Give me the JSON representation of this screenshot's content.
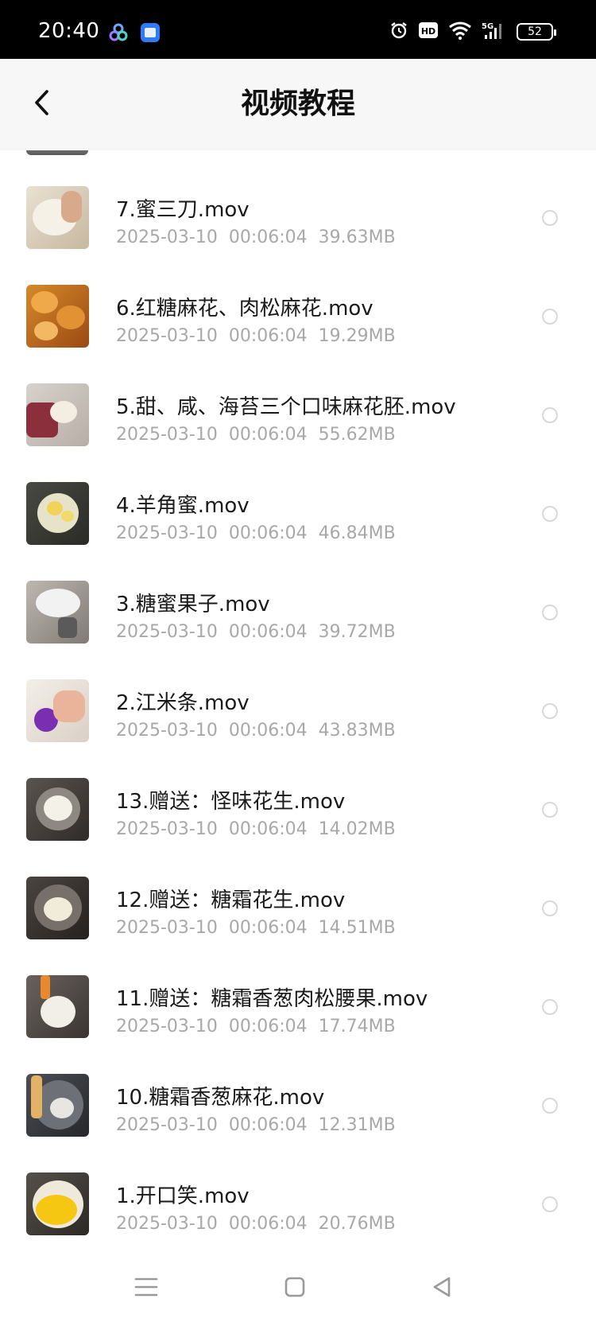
{
  "status_bar": {
    "time": "20:40",
    "battery_level": "52",
    "icons": [
      "app-cluster-icon",
      "app-square-icon",
      "alarm-icon",
      "hd-icon",
      "wifi-icon",
      "signal-5g-icon",
      "battery-icon"
    ]
  },
  "header": {
    "title": "视频教程",
    "back_icon": "chevron-left-icon"
  },
  "colors": {
    "title_text": "#111111",
    "name_text": "#1a1a1a",
    "meta_text": "#a8a8a8",
    "radio_border": "#d8d8d8",
    "status_bar_bg": "#000000",
    "header_bg": "#f7f7f7"
  },
  "videos": [
    {
      "name": "7.蜜三刀.mov",
      "date": "2025-03-10",
      "duration": "00:06:04",
      "size": "39.63MB"
    },
    {
      "name": "6.红糖麻花、肉松麻花.mov",
      "date": "2025-03-10",
      "duration": "00:06:04",
      "size": "19.29MB"
    },
    {
      "name": "5.甜、咸、海苔三个口味麻花胚.mov",
      "date": "2025-03-10",
      "duration": "00:06:04",
      "size": "55.62MB"
    },
    {
      "name": "4.羊角蜜.mov",
      "date": "2025-03-10",
      "duration": "00:06:04",
      "size": "46.84MB"
    },
    {
      "name": "3.糖蜜果子.mov",
      "date": "2025-03-10",
      "duration": "00:06:04",
      "size": "39.72MB"
    },
    {
      "name": "2.江米条.mov",
      "date": "2025-03-10",
      "duration": "00:06:04",
      "size": "43.83MB"
    },
    {
      "name": "13.赠送：怪味花生.mov",
      "date": "2025-03-10",
      "duration": "00:06:04",
      "size": "14.02MB"
    },
    {
      "name": "12.赠送：糖霜花生.mov",
      "date": "2025-03-10",
      "duration": "00:06:04",
      "size": "14.51MB"
    },
    {
      "name": "11.赠送：糖霜香葱肉松腰果.mov",
      "date": "2025-03-10",
      "duration": "00:06:04",
      "size": "17.74MB"
    },
    {
      "name": "10.糖霜香葱麻花.mov",
      "date": "2025-03-10",
      "duration": "00:06:04",
      "size": "12.31MB"
    },
    {
      "name": "1.开口笑.mov",
      "date": "2025-03-10",
      "duration": "00:06:04",
      "size": "20.76MB"
    }
  ],
  "system_nav": {
    "buttons": [
      "menu-icon",
      "home-icon",
      "back-triangle-icon"
    ]
  }
}
